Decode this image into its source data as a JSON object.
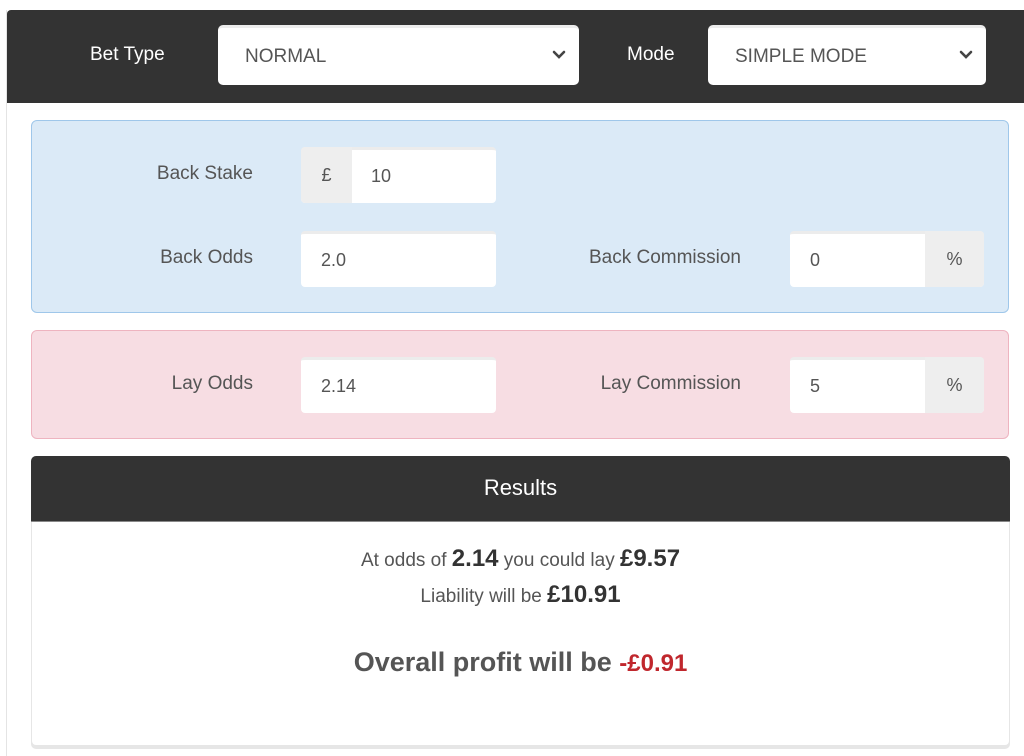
{
  "header": {
    "bet_type_label": "Bet Type",
    "bet_type_value": "NORMAL",
    "mode_label": "Mode",
    "mode_value": "SIMPLE MODE"
  },
  "back": {
    "stake_label": "Back Stake",
    "stake_prefix": "£",
    "stake_value": "10",
    "odds_label": "Back Odds",
    "odds_value": "2.0",
    "commission_label": "Back Commission",
    "commission_value": "0",
    "commission_suffix": "%"
  },
  "lay": {
    "odds_label": "Lay Odds",
    "odds_value": "2.14",
    "commission_label": "Lay Commission",
    "commission_value": "5",
    "commission_suffix": "%"
  },
  "results": {
    "title": "Results",
    "line1_prefix": "At odds of ",
    "line1_odds": "2.14",
    "line1_middle": " you could lay ",
    "line1_amount": "£9.57",
    "line2_prefix": "Liability will be ",
    "line2_amount": "£10.91",
    "line3_prefix": "Overall profit will be ",
    "line3_amount": "-£0.91"
  },
  "colors": {
    "header_bg": "#333333",
    "back_panel": "#dbeaf7",
    "lay_panel": "#f7dde3",
    "negative": "#c0272d"
  }
}
